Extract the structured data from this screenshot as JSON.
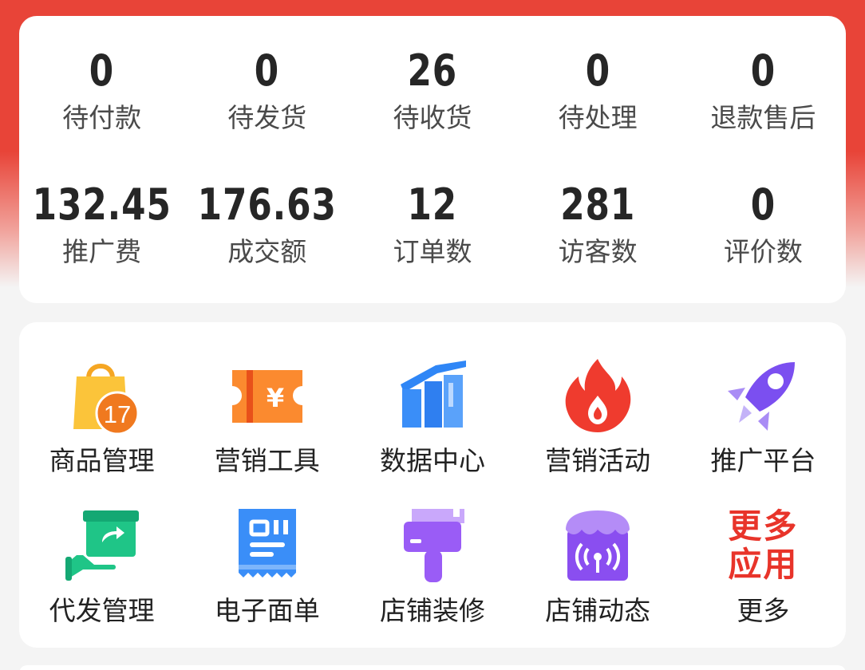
{
  "stats": {
    "row1": [
      {
        "value": "0",
        "label": "待付款"
      },
      {
        "value": "0",
        "label": "待发货"
      },
      {
        "value": "26",
        "label": "待收货"
      },
      {
        "value": "0",
        "label": "待处理"
      },
      {
        "value": "0",
        "label": "退款售后"
      }
    ],
    "row2": [
      {
        "value": "132.45",
        "label": "推广费"
      },
      {
        "value": "176.63",
        "label": "成交额"
      },
      {
        "value": "12",
        "label": "订单数"
      },
      {
        "value": "281",
        "label": "访客数"
      },
      {
        "value": "0",
        "label": "评价数"
      }
    ]
  },
  "apps": {
    "row1": [
      {
        "label": "商品管理",
        "icon": "shopping-bag-icon",
        "badge": "17"
      },
      {
        "label": "营销工具",
        "icon": "coupon-ticket-icon",
        "symbol": "¥"
      },
      {
        "label": "数据中心",
        "icon": "bar-chart-icon"
      },
      {
        "label": "营销活动",
        "icon": "flame-icon"
      },
      {
        "label": "推广平台",
        "icon": "rocket-icon"
      }
    ],
    "row2": [
      {
        "label": "代发管理",
        "icon": "hand-box-icon"
      },
      {
        "label": "电子面单",
        "icon": "receipt-icon"
      },
      {
        "label": "店铺装修",
        "icon": "paint-brush-icon"
      },
      {
        "label": "店铺动态",
        "icon": "store-broadcast-icon"
      },
      {
        "label": "更多",
        "icon": "more-apps-icon",
        "icon_text_line1": "更多",
        "icon_text_line2": "应用"
      }
    ]
  },
  "colors": {
    "header_red": "#e84438",
    "background": "#f4f4f4",
    "card": "#ffffff",
    "more_red": "#e8342a"
  }
}
